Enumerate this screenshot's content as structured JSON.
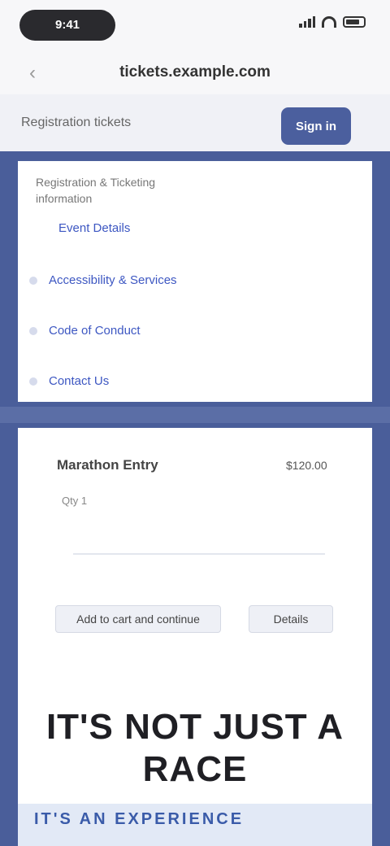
{
  "status_bar": {
    "time": "9:41"
  },
  "header": {
    "title": "tickets.example.com"
  },
  "toolbar": {
    "label": "Registration tickets",
    "button": "Sign in"
  },
  "menu": {
    "heading": "Registration & Ticketing information",
    "items": [
      "Event Details",
      "Accessibility & Services",
      "Code of Conduct",
      "Contact Us"
    ]
  },
  "ticket": {
    "title": "Marathon Entry",
    "price": "$120.00",
    "meta": "Qty 1",
    "button_primary": "Add to cart and continue",
    "button_secondary": "Details"
  },
  "headline": "IT'S NOT JUST A RACE",
  "bottom_text": "IT'S AN EXPERIENCE"
}
